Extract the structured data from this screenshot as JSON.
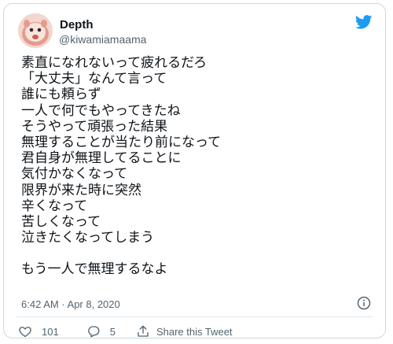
{
  "tweet": {
    "author": {
      "name": "Depth",
      "handle": "@kiwamiamaama",
      "avatar_icon": "avatar"
    },
    "text_lines": [
      "素直になれないって疲れるだろ",
      "「大丈夫」なんて言って",
      "誰にも頼らず",
      "一人で何でもやってきたね",
      "そうやって頑張った結果",
      "無理することが当たり前になって",
      "君自身が無理してることに",
      "気付かなくなって",
      "限界が来た時に突然",
      "辛くなって",
      "苦しくなって",
      "泣きたくなってしまう",
      "",
      "もう一人で無理するなよ"
    ],
    "timestamp": "6:42 AM · Apr 8, 2020",
    "like_count": "101",
    "reply_count": "5",
    "share_label": "Share this Tweet"
  },
  "colors": {
    "twitter_blue": "#1d9bf0",
    "text_primary": "#0f1419",
    "text_secondary": "#536471",
    "border": "#cfd9de"
  }
}
